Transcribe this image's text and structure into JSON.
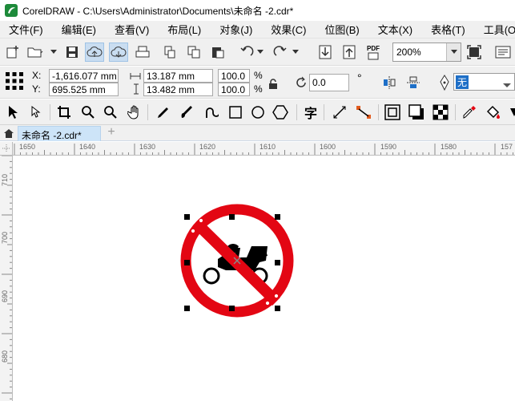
{
  "window": {
    "title": "CorelDRAW - C:\\Users\\Administrator\\Documents\\未命名 -2.cdr*"
  },
  "menu": [
    "文件(F)",
    "编辑(E)",
    "查看(V)",
    "布局(L)",
    "对象(J)",
    "效果(C)",
    "位图(B)",
    "文本(X)",
    "表格(T)",
    "工具(O)"
  ],
  "standard_toolbar": {
    "zoom": "200%",
    "pdf_label": "PDF"
  },
  "property_bar": {
    "x_label": "X:",
    "y_label": "Y:",
    "x_value": "-1,616.077 mm",
    "y_value": "695.525 mm",
    "width_value": "13.187 mm",
    "height_value": "13.482 mm",
    "scale_x": "100.0",
    "scale_y": "100.0",
    "percent": "%",
    "rotation": "0.0",
    "degree": "°",
    "outline": "无"
  },
  "toolbox": {
    "text_tool_glyph": "字"
  },
  "tabs": {
    "document_tab": "未命名 -2.cdr*",
    "add_tab": "+"
  },
  "ruler": {
    "horizontal": [
      "1650",
      "1640",
      "1630",
      "1620",
      "1610",
      "1600",
      "1590",
      "1580",
      "157"
    ],
    "vertical": [
      "710",
      "700",
      "690",
      "680"
    ]
  },
  "colors": {
    "sign_red": "#e30613",
    "accent_blue": "#c9ddf1",
    "tab_blue": "#cde4f8"
  }
}
